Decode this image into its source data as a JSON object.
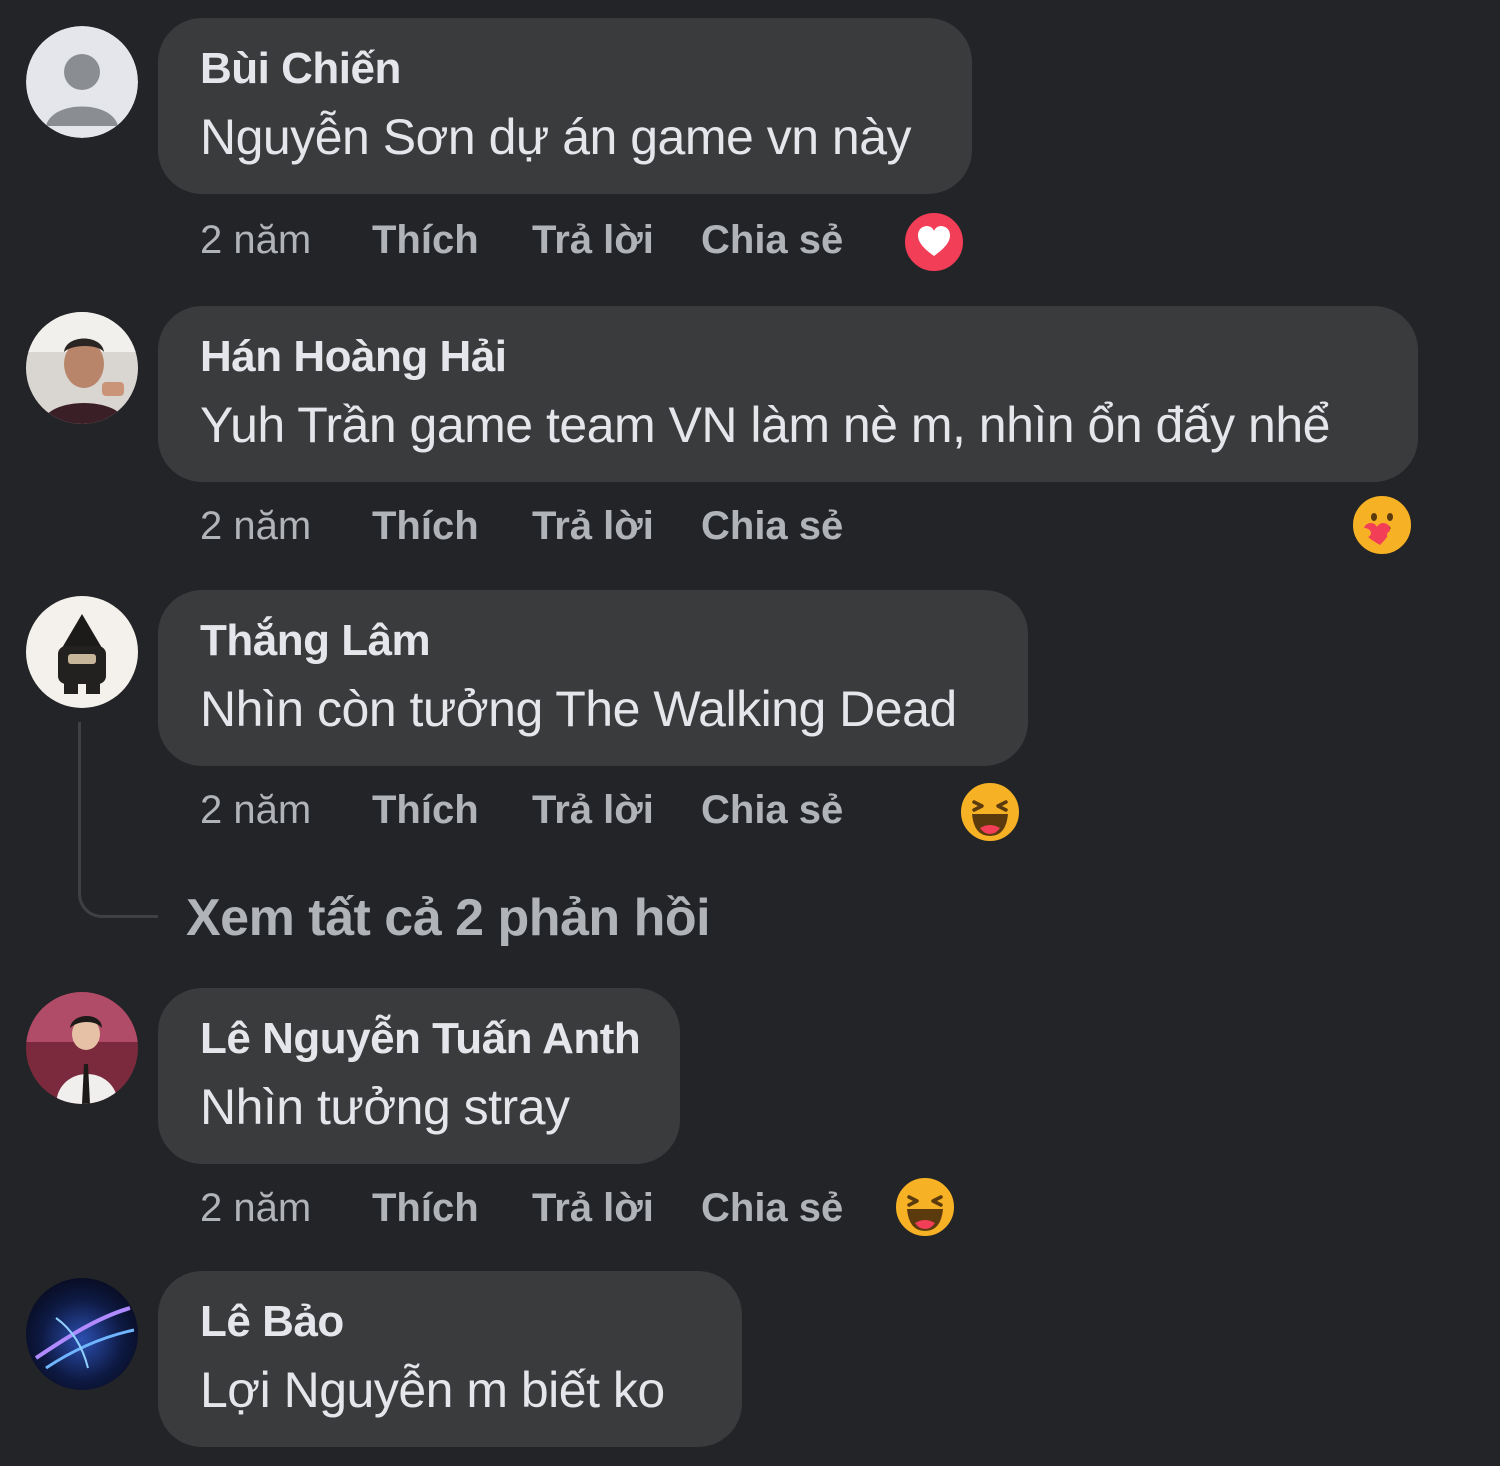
{
  "colors": {
    "background": "#232427",
    "bubble": "#3a3b3c",
    "primary_text": "#e4e6eb",
    "secondary_text": "#b0b3b8"
  },
  "comments": [
    {
      "author": "Bùi Chiến",
      "text": "Nguyễn Sơn dự án game vn này",
      "time": "2 năm",
      "like": "Thích",
      "reply": "Trả lời",
      "share": "Chia sẻ",
      "avatar": "default-user-avatar",
      "reaction": "heart-reaction-icon"
    },
    {
      "author": "Hán Hoàng Hải",
      "text": "Yuh Trần game team VN làm nè m, nhìn ổn đấy nhể",
      "time": "2 năm",
      "like": "Thích",
      "reply": "Trả lời",
      "share": "Chia sẻ",
      "avatar": "user-photo-avatar",
      "reaction": "care-reaction-icon"
    },
    {
      "author": "Thắng Lâm",
      "text": "Nhìn còn tưởng The Walking Dead",
      "time": "2 năm",
      "like": "Thích",
      "reply": "Trả lời",
      "share": "Chia sẻ",
      "avatar": "user-photo-avatar",
      "reaction": "haha-reaction-icon"
    },
    {
      "author": "Lê Nguyễn Tuấn Anth",
      "text": "Nhìn tưởng stray",
      "time": "2 năm",
      "like": "Thích",
      "reply": "Trả lời",
      "share": "Chia sẻ",
      "avatar": "user-photo-avatar",
      "reaction": "haha-reaction-icon"
    },
    {
      "author": "Lê Bảo",
      "text": "Lợi Nguyễn m biết ko",
      "avatar": "user-photo-avatar"
    }
  ],
  "view_replies": "Xem tất cả 2 phản hồi"
}
